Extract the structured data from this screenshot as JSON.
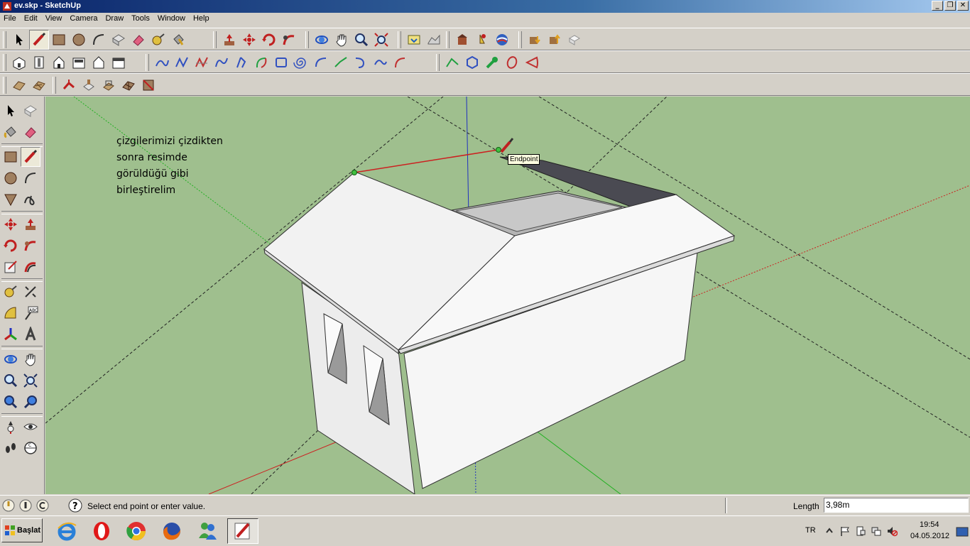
{
  "window": {
    "title": "ev.skp - SketchUp"
  },
  "menu": [
    "File",
    "Edit",
    "View",
    "Camera",
    "Draw",
    "Tools",
    "Window",
    "Help"
  ],
  "annotation": {
    "lines": [
      "çizgilerimizi çizdikten",
      "sonra resimde",
      "görüldüğü gibi",
      "birleştirelim"
    ]
  },
  "inference_tooltip": "Endpoint",
  "status": {
    "message": "Select end point or enter value.",
    "measure_label": "Length",
    "measure_value": "3,98m"
  },
  "tray": {
    "language": "TR",
    "time": "19:54",
    "date": "04.05.2012"
  },
  "start": {
    "label": "Başlat"
  },
  "colors": {
    "viewport": "#9fbf8e",
    "red_axis": "#cc2020",
    "green_axis": "#20b020",
    "blue_axis": "#2030c0",
    "roof": "#f0f0f0"
  }
}
